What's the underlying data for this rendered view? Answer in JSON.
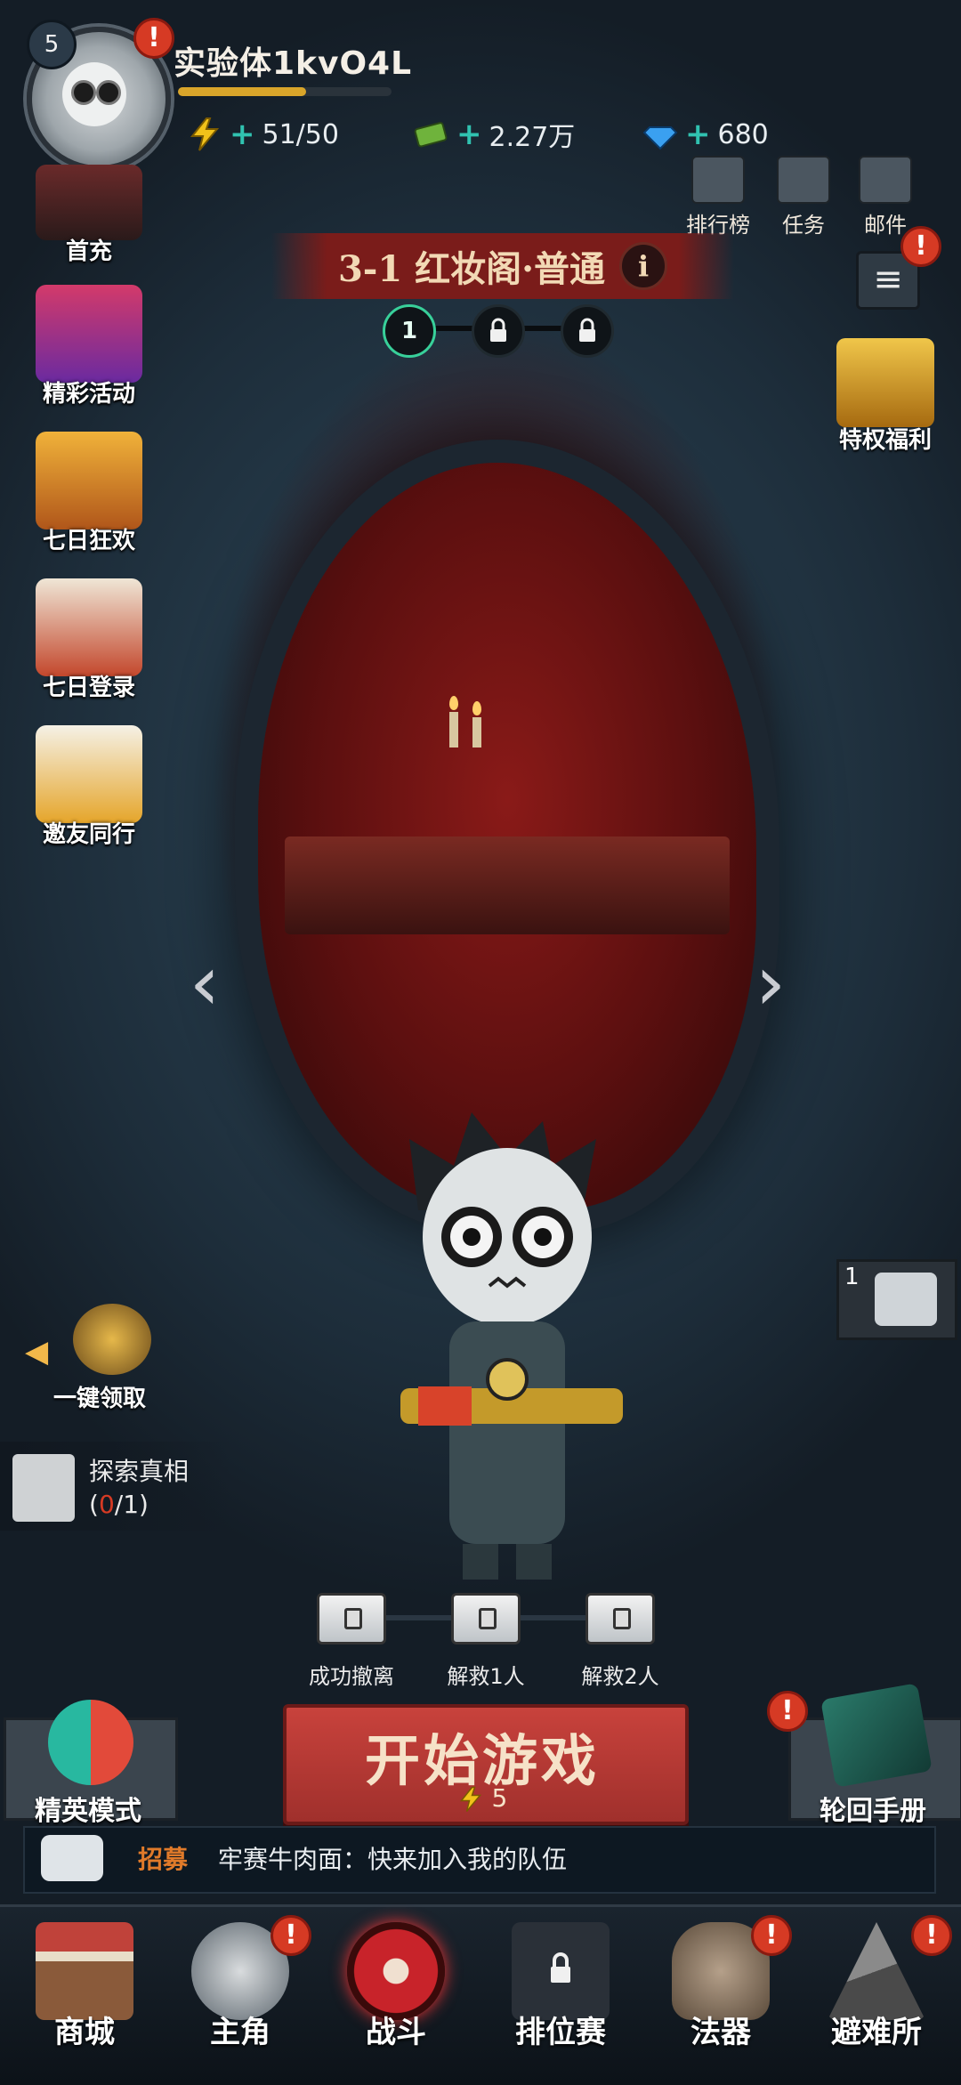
{
  "player": {
    "level": "5",
    "name": "实验体1kvO4L",
    "xp_fraction": 0.6,
    "energy": "51/50",
    "cash": "2.27万",
    "gems": "680"
  },
  "top_links": [
    {
      "label": "排行榜"
    },
    {
      "label": "任务"
    },
    {
      "label": "邮件"
    }
  ],
  "stage": {
    "title": "3-1 红妆阁·普通",
    "info": "i",
    "current_node": "1"
  },
  "left_menu": [
    {
      "label": "首充"
    },
    {
      "label": "精彩活动"
    },
    {
      "label": "七日狂欢"
    },
    {
      "label": "七日登录"
    },
    {
      "label": "邀友同行"
    }
  ],
  "right_menu": {
    "privilege": "特权福利",
    "count": "1"
  },
  "claim": {
    "label": "一键领取"
  },
  "explore": {
    "label": "探索真相",
    "progress_open": "(",
    "progress_done": "0",
    "progress_total": "/1)"
  },
  "rewards": [
    {
      "label": "成功撤离"
    },
    {
      "label": "解救1人"
    },
    {
      "label": "解救2人"
    }
  ],
  "buttons": {
    "elite": "精英模式",
    "start": "开始游戏",
    "start_cost": "5",
    "handbook": "轮回手册"
  },
  "chat": {
    "tag": "招募",
    "message": "牢赛牛肉面：快来加入我的队伍"
  },
  "nav": [
    {
      "label": "商城"
    },
    {
      "label": "主角"
    },
    {
      "label": "战斗"
    },
    {
      "label": "排位赛"
    },
    {
      "label": "法器"
    },
    {
      "label": "避难所"
    }
  ],
  "badge": "!",
  "colors": {
    "accent_red": "#c8423c",
    "badge_red": "#d63a24",
    "teal_plus": "#30c2b0",
    "gold": "#d9a52a",
    "explore_zero": "#d63a24"
  }
}
